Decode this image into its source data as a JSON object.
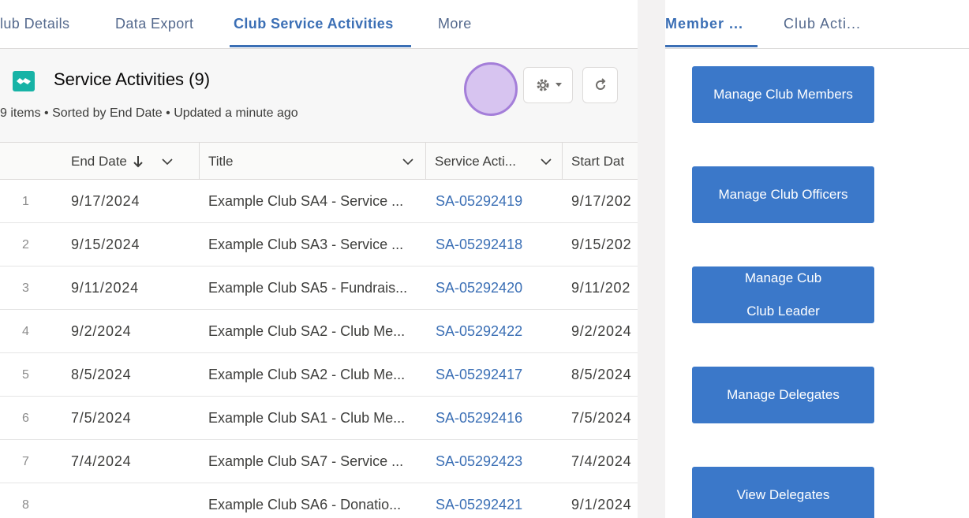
{
  "left": {
    "tabs": [
      {
        "label": "lub Details"
      },
      {
        "label": "Data Export"
      },
      {
        "label": "Club Service Activities"
      },
      {
        "label": "More"
      }
    ],
    "card": {
      "title": "Service Activities (9)",
      "subtitle": "9 items • Sorted by End Date • Updated a minute ago"
    },
    "columns": {
      "end_date": "End Date",
      "title": "Title",
      "service_activity": "Service Acti...",
      "start_date": "Start Dat"
    },
    "rows": [
      {
        "n": "1",
        "end": "9/17/2024",
        "title": "Example Club SA4 - Service ...",
        "sa": "SA-05292419",
        "start": "9/17/202"
      },
      {
        "n": "2",
        "end": "9/15/2024",
        "title": "Example Club SA3 - Service ...",
        "sa": "SA-05292418",
        "start": "9/15/202"
      },
      {
        "n": "3",
        "end": "9/11/2024",
        "title": "Example Club SA5 - Fundrais...",
        "sa": "SA-05292420",
        "start": "9/11/202"
      },
      {
        "n": "4",
        "end": "9/2/2024",
        "title": "Example Club SA2 - Club Me...",
        "sa": "SA-05292422",
        "start": "9/2/2024"
      },
      {
        "n": "5",
        "end": "8/5/2024",
        "title": "Example Club SA2 - Club Me...",
        "sa": "SA-05292417",
        "start": "8/5/2024"
      },
      {
        "n": "6",
        "end": "7/5/2024",
        "title": "Example Club SA1 - Club Me...",
        "sa": "SA-05292416",
        "start": "7/5/2024"
      },
      {
        "n": "7",
        "end": "7/4/2024",
        "title": "Example Club SA7 - Service ...",
        "sa": "SA-05292423",
        "start": "7/4/2024"
      },
      {
        "n": "8",
        "end": "",
        "title": "Example Club SA6 - Donatio...",
        "sa": "SA-05292421",
        "start": "9/1/2024"
      }
    ]
  },
  "right": {
    "tabs": [
      {
        "label": "Member ..."
      },
      {
        "label": "Club Acti..."
      }
    ],
    "buttons": [
      {
        "label": "Manage Club Members"
      },
      {
        "label": "Manage Club Officers"
      },
      {
        "label": "Manage Cub Club Leader"
      },
      {
        "label": "Manage Delegates"
      },
      {
        "label": "View Delegates"
      }
    ]
  },
  "colors": {
    "accent": "#3b6fb5",
    "button": "#3b78c9",
    "card_icon": "#17b3a6",
    "click_indicator": "#d7c4f0"
  },
  "icons": {
    "card": "handshake-icon",
    "settings": "gear-icon",
    "refresh": "refresh-icon",
    "sort": "arrow-down-icon",
    "column_menu": "chevron-down-icon"
  }
}
